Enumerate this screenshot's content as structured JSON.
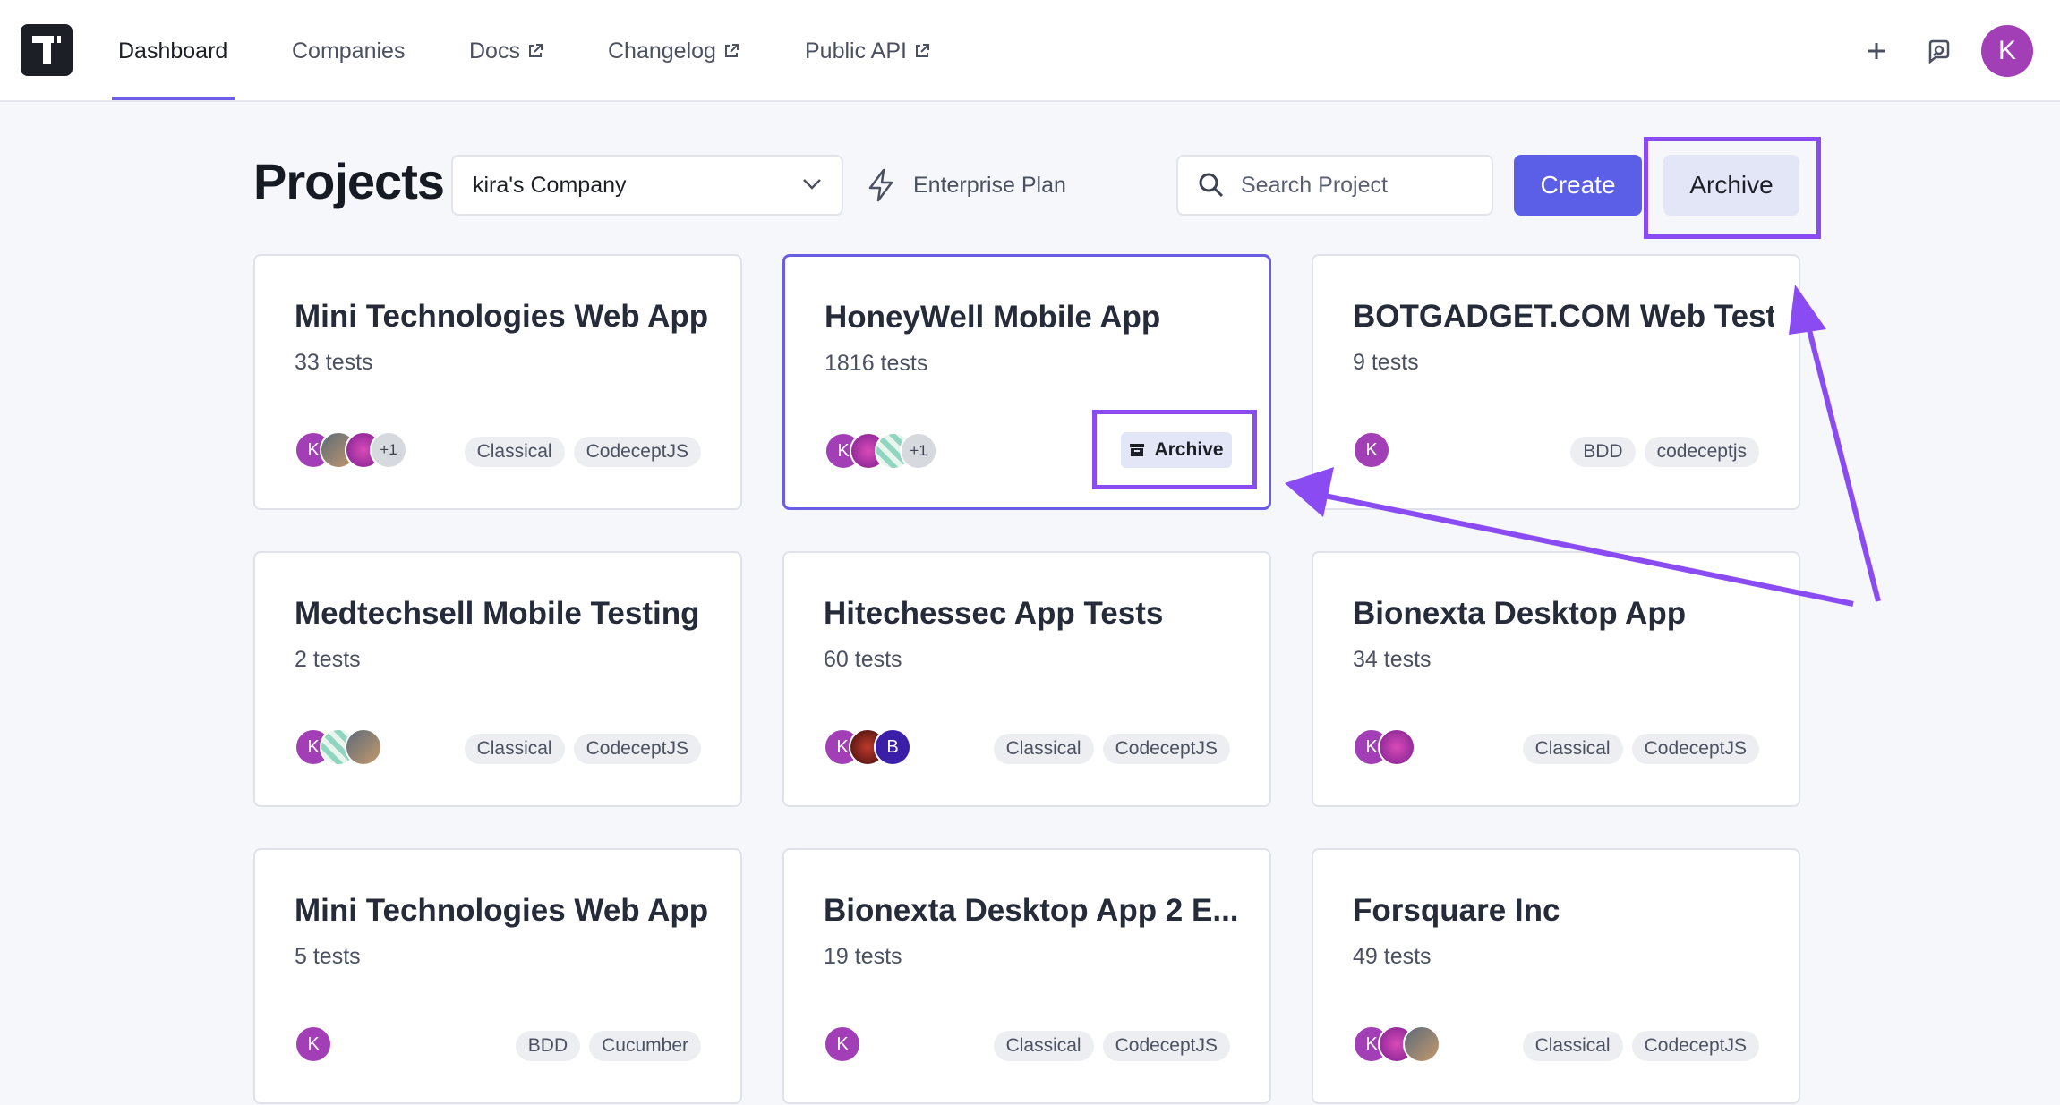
{
  "nav": {
    "items": [
      {
        "label": "Dashboard",
        "external": false
      },
      {
        "label": "Companies",
        "external": false
      },
      {
        "label": "Docs",
        "external": true
      },
      {
        "label": "Changelog",
        "external": true
      },
      {
        "label": "Public API",
        "external": true
      }
    ],
    "active": "Dashboard",
    "user_initial": "K"
  },
  "header": {
    "title": "Projects",
    "company": "kira's Company",
    "plan": "Enterprise Plan",
    "search_placeholder": "Search Project",
    "create_label": "Create",
    "archive_label": "Archive"
  },
  "projects": [
    {
      "name": "Mini Technologies Web App",
      "tests": "33 tests",
      "avatars": [
        "K",
        "",
        "",
        "+1"
      ],
      "tags": [
        "Classical",
        "CodeceptJS"
      ]
    },
    {
      "name": "HoneyWell Mobile App",
      "tests": "1816 tests",
      "avatars": [
        "K",
        "",
        "",
        "+1"
      ],
      "tags": [],
      "archive_label": "Archive",
      "selected": true
    },
    {
      "name": "BOTGADGET.COM Web Test...",
      "tests": "9 tests",
      "avatars": [
        "K"
      ],
      "tags": [
        "BDD",
        "codeceptjs"
      ]
    },
    {
      "name": "Medtechsell Mobile Testing",
      "tests": "2 tests",
      "avatars": [
        "K",
        "",
        ""
      ],
      "tags": [
        "Classical",
        "CodeceptJS"
      ]
    },
    {
      "name": "Hitechessec App Tests",
      "tests": "60 tests",
      "avatars": [
        "K",
        "",
        "B"
      ],
      "tags": [
        "Classical",
        "CodeceptJS"
      ]
    },
    {
      "name": "Bionexta Desktop App",
      "tests": "34 tests",
      "avatars": [
        "K",
        ""
      ],
      "tags": [
        "Classical",
        "CodeceptJS"
      ]
    },
    {
      "name": "Mini Technologies Web App",
      "tests": "5 tests",
      "avatars": [
        "K"
      ],
      "tags": [
        "BDD",
        "Cucumber"
      ]
    },
    {
      "name": "Bionexta Desktop App 2 E...",
      "tests": "19 tests",
      "avatars": [
        "K"
      ],
      "tags": [
        "Classical",
        "CodeceptJS"
      ]
    },
    {
      "name": "Forsquare Inc",
      "tests": "49 tests",
      "avatars": [
        "K",
        "",
        ""
      ],
      "tags": [
        "Classical",
        "CodeceptJS"
      ]
    }
  ],
  "colors": {
    "accent": "#5b5ee6",
    "highlight": "#8a4cf2",
    "avatar_primary": "#a23fb7"
  }
}
